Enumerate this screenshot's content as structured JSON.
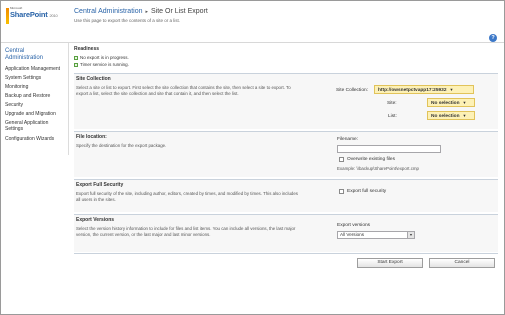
{
  "brand": {
    "ms": "Microsoft",
    "product": "SharePoint",
    "version": "2010"
  },
  "header": {
    "breadcrumb_root": "Central Administration",
    "breadcrumb_sep": "▸",
    "title": "Site Or List Export",
    "subtitle": "Use this page to export the contents of a site or a list.",
    "help": "?"
  },
  "leftnav": {
    "heading": "Central Administration",
    "items": [
      "Application Management",
      "System Settings",
      "Monitoring",
      "Backup and Restore",
      "Security",
      "Upgrade and Migration",
      "General Application Settings",
      "Configuration Wizards"
    ]
  },
  "readiness": {
    "title": "Readiness",
    "lines": [
      "No export is in progress.",
      "Timer service is running."
    ]
  },
  "site_collection": {
    "title": "Site Collection",
    "description": "Select a site or list to export.  First select the site collection that contains the site, then select a site to export. To export a list, select the site collection and site that contain it, and then select the list.",
    "label_sc": "Site Collection:",
    "value_sc": "http://owsnetpctvapp17:25932",
    "label_site": "Site:",
    "value_site": "No selection",
    "label_list": "List:",
    "value_list": "No selection"
  },
  "file_location": {
    "title": "File location:",
    "description": "Specify the destination for the export package.",
    "filename_label": "Filename:",
    "filename_value": "",
    "overwrite_label": "Overwrite existing files",
    "example": "Example: \\\\backup\\SharePoint\\export.cmp"
  },
  "full_security": {
    "title": "Export Full Security",
    "description": "Export full security of the site, including author, editors, created by times, and modified by times. This also includes all users in the sites.",
    "checkbox_label": "Export full security"
  },
  "versions": {
    "title": "Export Versions",
    "description": "Select the version history information to include for files and list items. You can include all versions, the last major version, the current version, or the last major and last minor versions.",
    "label": "Export versions",
    "selected": "All Versions"
  },
  "actions": {
    "start": "Start Export",
    "cancel": "Cancel"
  },
  "colors": {
    "accent": "#2a64a8",
    "selector_bg": "#fdf1b6",
    "section_bg": "#f7f7f7"
  }
}
